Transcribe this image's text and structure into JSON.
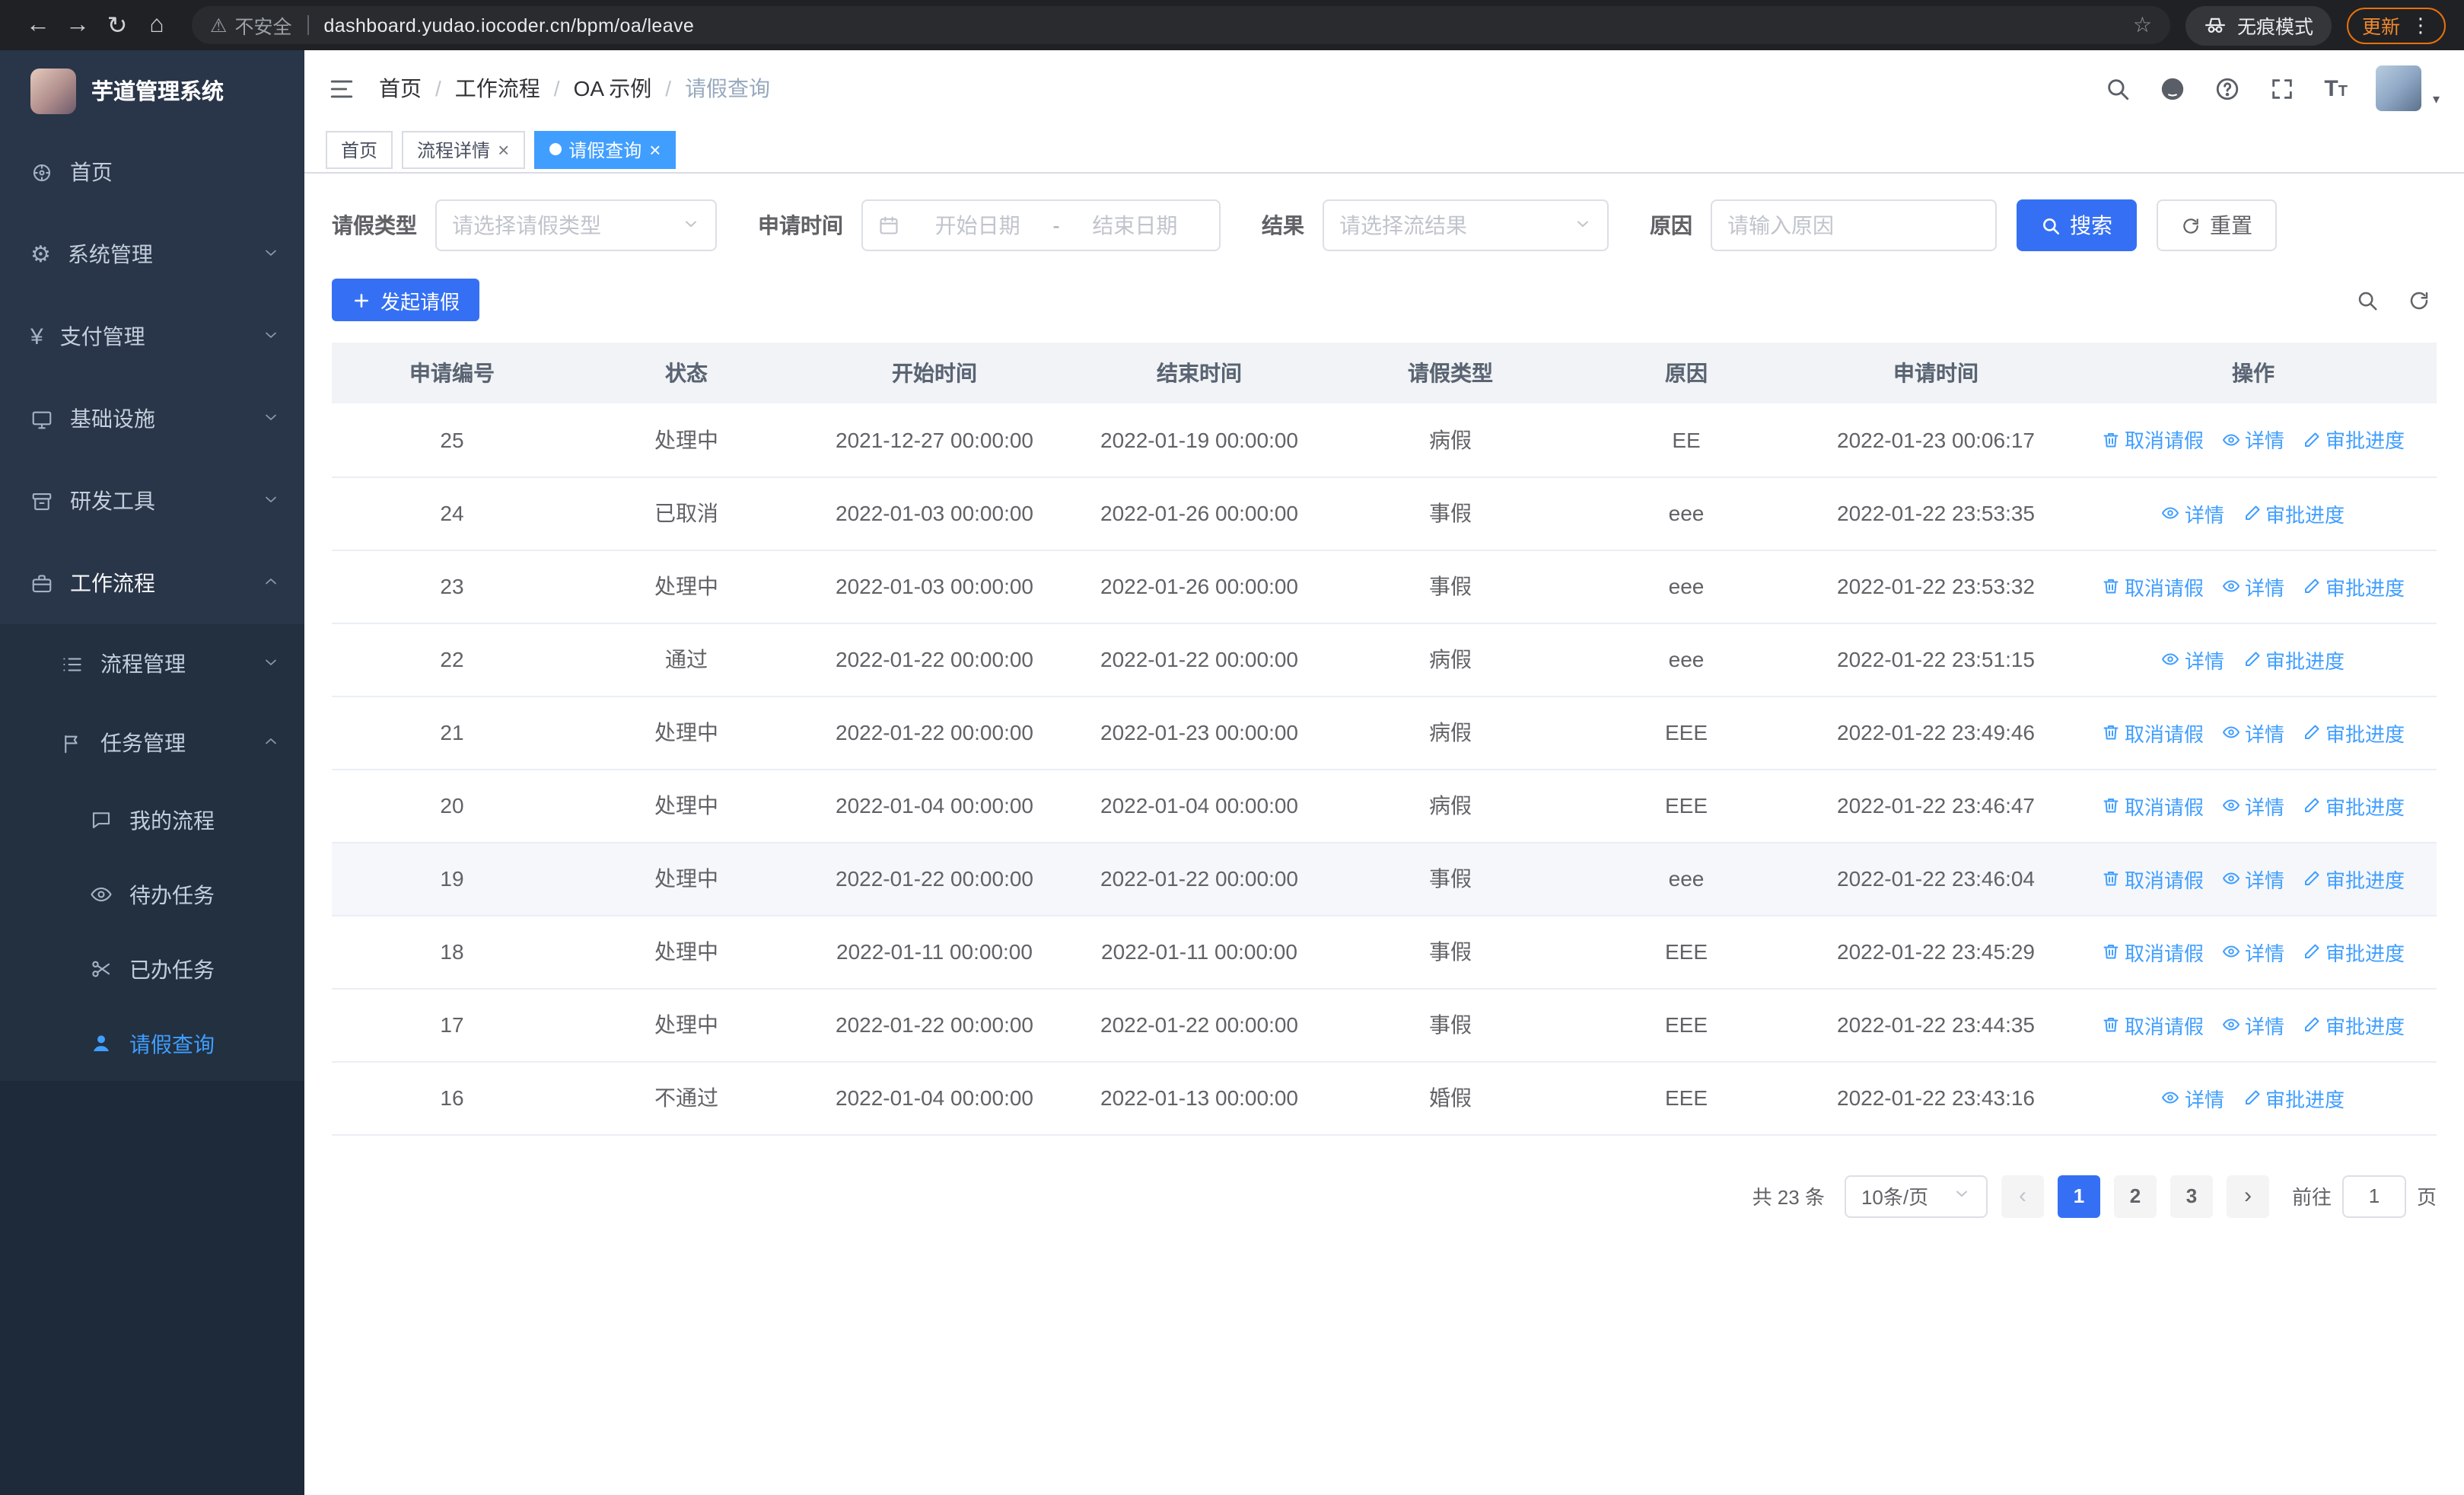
{
  "browser": {
    "security_label": "不安全",
    "url": "dashboard.yudao.iocoder.cn/bpm/oa/leave",
    "incognito_label": "无痕模式",
    "update_label": "更新"
  },
  "sidebar": {
    "logo_title": "芋道管理系统",
    "items": [
      {
        "label": "首页",
        "icon": "compass"
      },
      {
        "label": "系统管理",
        "icon": "gear",
        "chevron": "down"
      },
      {
        "label": "支付管理",
        "icon": "yen",
        "chevron": "down"
      },
      {
        "label": "基础设施",
        "icon": "monitor",
        "chevron": "down"
      },
      {
        "label": "研发工具",
        "icon": "box",
        "chevron": "down"
      },
      {
        "label": "工作流程",
        "icon": "briefcase",
        "chevron": "up",
        "active": true
      }
    ],
    "submenu": [
      {
        "label": "流程管理",
        "icon": "list",
        "expanded": false
      },
      {
        "label": "任务管理",
        "icon": "flag",
        "expanded": true,
        "children": [
          {
            "label": "我的流程",
            "icon": "chat"
          },
          {
            "label": "待办任务",
            "icon": "eye"
          },
          {
            "label": "已办任务",
            "icon": "scissors"
          },
          {
            "label": "请假查询",
            "icon": "user",
            "active": true
          }
        ]
      }
    ]
  },
  "header": {
    "breadcrumb": [
      "首页",
      "工作流程",
      "OA 示例",
      "请假查询"
    ]
  },
  "tabs": [
    {
      "label": "首页"
    },
    {
      "label": "流程详情"
    },
    {
      "label": "请假查询"
    }
  ],
  "filters": {
    "leave_type_label": "请假类型",
    "leave_type_placeholder": "请选择请假类型",
    "apply_time_label": "申请时间",
    "start_date_placeholder": "开始日期",
    "date_separator": "-",
    "end_date_placeholder": "结束日期",
    "result_label": "结果",
    "result_placeholder": "请选择流结果",
    "reason_label": "原因",
    "reason_placeholder": "请输入原因",
    "search_label": "搜索",
    "reset_label": "重置"
  },
  "toolbar": {
    "create_label": "发起请假"
  },
  "table": {
    "columns": [
      "申请编号",
      "状态",
      "开始时间",
      "结束时间",
      "请假类型",
      "原因",
      "申请时间",
      "操作"
    ],
    "action_labels": {
      "cancel": "取消请假",
      "detail": "详情",
      "progress": "审批进度"
    },
    "rows": [
      {
        "id": "25",
        "status": "处理中",
        "start": "2021-12-27 00:00:00",
        "end": "2022-01-19 00:00:00",
        "type": "病假",
        "reason": "EE",
        "applied": "2022-01-23 00:06:17",
        "actions": [
          "cancel",
          "detail",
          "progress"
        ]
      },
      {
        "id": "24",
        "status": "已取消",
        "start": "2022-01-03 00:00:00",
        "end": "2022-01-26 00:00:00",
        "type": "事假",
        "reason": "eee",
        "applied": "2022-01-22 23:53:35",
        "actions": [
          "detail",
          "progress"
        ]
      },
      {
        "id": "23",
        "status": "处理中",
        "start": "2022-01-03 00:00:00",
        "end": "2022-01-26 00:00:00",
        "type": "事假",
        "reason": "eee",
        "applied": "2022-01-22 23:53:32",
        "actions": [
          "cancel",
          "detail",
          "progress"
        ]
      },
      {
        "id": "22",
        "status": "通过",
        "start": "2022-01-22 00:00:00",
        "end": "2022-01-22 00:00:00",
        "type": "病假",
        "reason": "eee",
        "applied": "2022-01-22 23:51:15",
        "actions": [
          "detail",
          "progress"
        ]
      },
      {
        "id": "21",
        "status": "处理中",
        "start": "2022-01-22 00:00:00",
        "end": "2022-01-23 00:00:00",
        "type": "病假",
        "reason": "EEE",
        "applied": "2022-01-22 23:49:46",
        "actions": [
          "cancel",
          "detail",
          "progress"
        ]
      },
      {
        "id": "20",
        "status": "处理中",
        "start": "2022-01-04 00:00:00",
        "end": "2022-01-04 00:00:00",
        "type": "病假",
        "reason": "EEE",
        "applied": "2022-01-22 23:46:47",
        "actions": [
          "cancel",
          "detail",
          "progress"
        ]
      },
      {
        "id": "19",
        "status": "处理中",
        "start": "2022-01-22 00:00:00",
        "end": "2022-01-22 00:00:00",
        "type": "事假",
        "reason": "eee",
        "applied": "2022-01-22 23:46:04",
        "actions": [
          "cancel",
          "detail",
          "progress"
        ],
        "highlight": true
      },
      {
        "id": "18",
        "status": "处理中",
        "start": "2022-01-11 00:00:00",
        "end": "2022-01-11 00:00:00",
        "type": "事假",
        "reason": "EEE",
        "applied": "2022-01-22 23:45:29",
        "actions": [
          "cancel",
          "detail",
          "progress"
        ]
      },
      {
        "id": "17",
        "status": "处理中",
        "start": "2022-01-22 00:00:00",
        "end": "2022-01-22 00:00:00",
        "type": "事假",
        "reason": "EEE",
        "applied": "2022-01-22 23:44:35",
        "actions": [
          "cancel",
          "detail",
          "progress"
        ]
      },
      {
        "id": "16",
        "status": "不通过",
        "start": "2022-01-04 00:00:00",
        "end": "2022-01-13 00:00:00",
        "type": "婚假",
        "reason": "EEE",
        "applied": "2022-01-22 23:43:16",
        "actions": [
          "detail",
          "progress"
        ]
      }
    ]
  },
  "pagination": {
    "total_text": "共 23 条",
    "page_size_text": "10条/页",
    "pages": [
      "1",
      "2",
      "3"
    ],
    "active_page": "1",
    "goto_label": "前往",
    "goto_value": "1",
    "page_suffix": "页"
  }
}
